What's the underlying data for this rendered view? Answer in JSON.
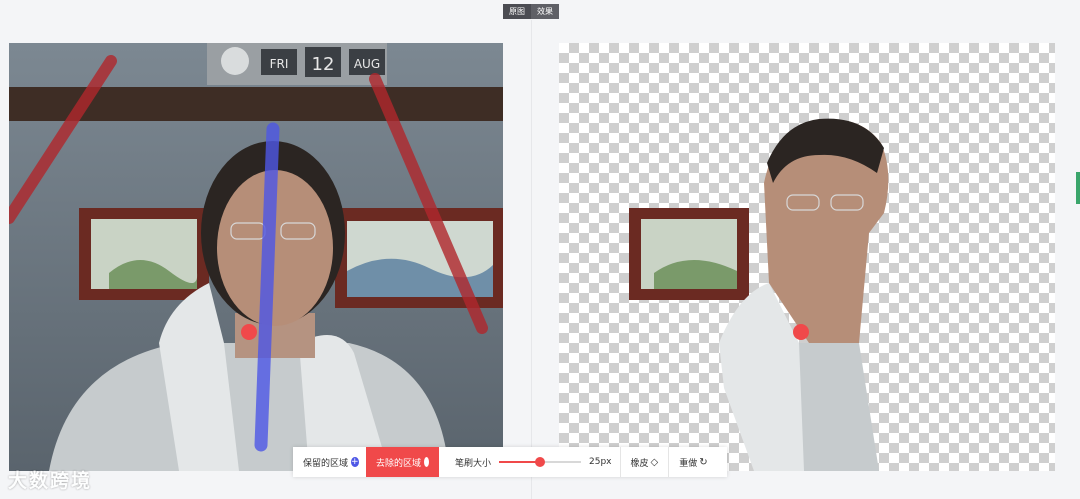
{
  "tabs": [
    {
      "label": "原图"
    },
    {
      "label": "效果"
    }
  ],
  "calendar": {
    "day": "FRI",
    "date": "12",
    "month": "AUG"
  },
  "toolbar": {
    "keep_label": "保留的区域",
    "remove_label": "去除的区域",
    "brush_label": "笔刷大小",
    "brush_value": "25px",
    "brush_level": 0.5,
    "eraser_label": "橡皮",
    "redo_label": "重做"
  },
  "watermark": "大数跨境",
  "colors": {
    "accent": "#f0494a",
    "keep_stroke": "#4e57e6",
    "remove_stroke": "#b0272c"
  }
}
